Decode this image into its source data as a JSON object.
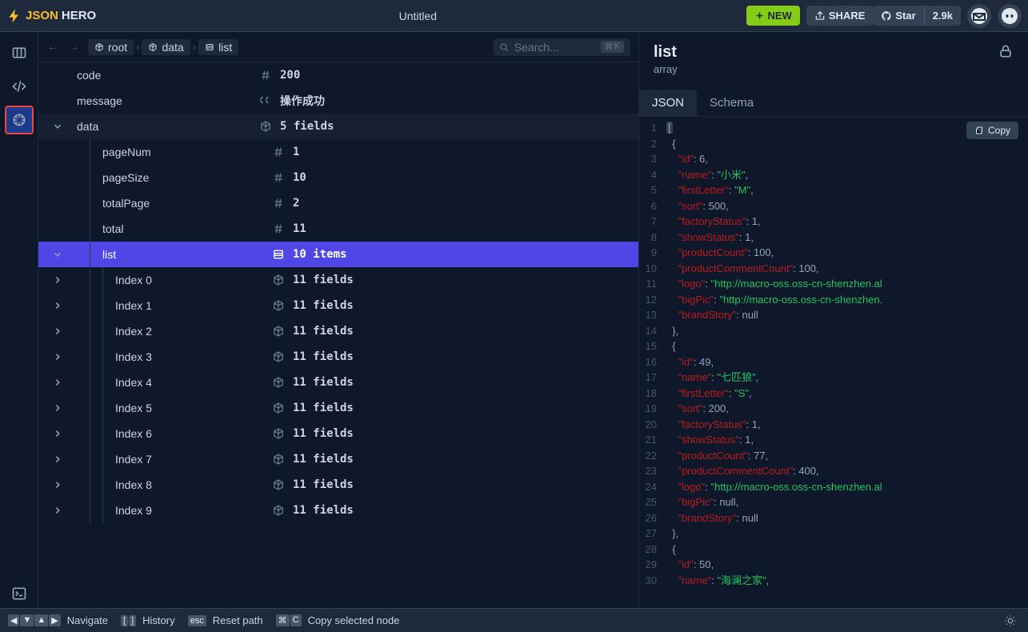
{
  "header": {
    "logo_json": "JSON",
    "logo_hero": "HERO",
    "title": "Untitled",
    "new_label": "NEW",
    "share_label": "SHARE",
    "star_label": "Star",
    "star_count": "2.9k"
  },
  "toolbar": {
    "breadcrumbs": [
      {
        "icon": "cube",
        "label": "root"
      },
      {
        "icon": "cube",
        "label": "data"
      },
      {
        "icon": "list",
        "label": "list"
      }
    ],
    "search_placeholder": "Search...",
    "search_shortcut_mod": "⌘",
    "search_shortcut_key": "K"
  },
  "tree_rows": [
    {
      "depth": 0,
      "chevron": "",
      "label": "code",
      "icon": "hash",
      "value": "200"
    },
    {
      "depth": 0,
      "chevron": "",
      "label": "message",
      "icon": "quote",
      "value": "操作成功"
    },
    {
      "depth": 0,
      "chevron": "down",
      "label": "data",
      "icon": "cube",
      "value": "5 fields",
      "class": "data-row"
    },
    {
      "depth": 1,
      "chevron": "",
      "label": "pageNum",
      "icon": "hash",
      "value": "1"
    },
    {
      "depth": 1,
      "chevron": "",
      "label": "pageSize",
      "icon": "hash",
      "value": "10"
    },
    {
      "depth": 1,
      "chevron": "",
      "label": "totalPage",
      "icon": "hash",
      "value": "2"
    },
    {
      "depth": 1,
      "chevron": "",
      "label": "total",
      "icon": "hash",
      "value": "11"
    },
    {
      "depth": 1,
      "chevron": "down",
      "label": "list",
      "icon": "list",
      "value": "10 items",
      "selected": true
    },
    {
      "depth": 2,
      "chevron": "right",
      "label": "Index 0",
      "icon": "cube",
      "value": "11 fields"
    },
    {
      "depth": 2,
      "chevron": "right",
      "label": "Index 1",
      "icon": "cube",
      "value": "11 fields"
    },
    {
      "depth": 2,
      "chevron": "right",
      "label": "Index 2",
      "icon": "cube",
      "value": "11 fields"
    },
    {
      "depth": 2,
      "chevron": "right",
      "label": "Index 3",
      "icon": "cube",
      "value": "11 fields"
    },
    {
      "depth": 2,
      "chevron": "right",
      "label": "Index 4",
      "icon": "cube",
      "value": "11 fields"
    },
    {
      "depth": 2,
      "chevron": "right",
      "label": "Index 5",
      "icon": "cube",
      "value": "11 fields"
    },
    {
      "depth": 2,
      "chevron": "right",
      "label": "Index 6",
      "icon": "cube",
      "value": "11 fields"
    },
    {
      "depth": 2,
      "chevron": "right",
      "label": "Index 7",
      "icon": "cube",
      "value": "11 fields"
    },
    {
      "depth": 2,
      "chevron": "right",
      "label": "Index 8",
      "icon": "cube",
      "value": "11 fields"
    },
    {
      "depth": 2,
      "chevron": "right",
      "label": "Index 9",
      "icon": "cube",
      "value": "11 fields"
    }
  ],
  "right": {
    "title": "list",
    "type": "array",
    "tab_json": "JSON",
    "tab_schema": "Schema",
    "copy_label": "Copy"
  },
  "code_lines": [
    {
      "n": 1,
      "t": [
        {
          "c": "p",
          "v": "[",
          "hl": true
        }
      ]
    },
    {
      "n": 2,
      "t": [
        {
          "c": "p",
          "v": "  {"
        }
      ]
    },
    {
      "n": 3,
      "t": [
        {
          "c": "p",
          "v": "    "
        },
        {
          "c": "k",
          "v": "\"id\""
        },
        {
          "c": "p",
          "v": ": "
        },
        {
          "c": "n",
          "v": "6"
        },
        {
          "c": "p",
          "v": ","
        }
      ]
    },
    {
      "n": 4,
      "t": [
        {
          "c": "p",
          "v": "    "
        },
        {
          "c": "k",
          "v": "\"name\""
        },
        {
          "c": "p",
          "v": ": "
        },
        {
          "c": "s",
          "v": "\"小米\""
        },
        {
          "c": "p",
          "v": ","
        }
      ]
    },
    {
      "n": 5,
      "t": [
        {
          "c": "p",
          "v": "    "
        },
        {
          "c": "k",
          "v": "\"firstLetter\""
        },
        {
          "c": "p",
          "v": ": "
        },
        {
          "c": "s",
          "v": "\"M\""
        },
        {
          "c": "p",
          "v": ","
        }
      ]
    },
    {
      "n": 6,
      "t": [
        {
          "c": "p",
          "v": "    "
        },
        {
          "c": "k",
          "v": "\"sort\""
        },
        {
          "c": "p",
          "v": ": "
        },
        {
          "c": "n",
          "v": "500"
        },
        {
          "c": "p",
          "v": ","
        }
      ]
    },
    {
      "n": 7,
      "t": [
        {
          "c": "p",
          "v": "    "
        },
        {
          "c": "k",
          "v": "\"factoryStatus\""
        },
        {
          "c": "p",
          "v": ": "
        },
        {
          "c": "n",
          "v": "1"
        },
        {
          "c": "p",
          "v": ","
        }
      ]
    },
    {
      "n": 8,
      "t": [
        {
          "c": "p",
          "v": "    "
        },
        {
          "c": "k",
          "v": "\"showStatus\""
        },
        {
          "c": "p",
          "v": ": "
        },
        {
          "c": "n",
          "v": "1"
        },
        {
          "c": "p",
          "v": ","
        }
      ]
    },
    {
      "n": 9,
      "t": [
        {
          "c": "p",
          "v": "    "
        },
        {
          "c": "k",
          "v": "\"productCount\""
        },
        {
          "c": "p",
          "v": ": "
        },
        {
          "c": "n",
          "v": "100"
        },
        {
          "c": "p",
          "v": ","
        }
      ]
    },
    {
      "n": 10,
      "t": [
        {
          "c": "p",
          "v": "    "
        },
        {
          "c": "k",
          "v": "\"productCommentCount\""
        },
        {
          "c": "p",
          "v": ": "
        },
        {
          "c": "n",
          "v": "100"
        },
        {
          "c": "p",
          "v": ","
        }
      ]
    },
    {
      "n": 11,
      "t": [
        {
          "c": "p",
          "v": "    "
        },
        {
          "c": "k",
          "v": "\"logo\""
        },
        {
          "c": "p",
          "v": ": "
        },
        {
          "c": "s",
          "v": "\"http://macro-oss.oss-cn-shenzhen.al"
        }
      ]
    },
    {
      "n": 12,
      "t": [
        {
          "c": "p",
          "v": "    "
        },
        {
          "c": "k",
          "v": "\"bigPic\""
        },
        {
          "c": "p",
          "v": ": "
        },
        {
          "c": "s",
          "v": "\"http://macro-oss.oss-cn-shenzhen."
        }
      ]
    },
    {
      "n": 13,
      "t": [
        {
          "c": "p",
          "v": "    "
        },
        {
          "c": "k",
          "v": "\"brandStory\""
        },
        {
          "c": "p",
          "v": ": "
        },
        {
          "c": "v",
          "v": "null"
        }
      ]
    },
    {
      "n": 14,
      "t": [
        {
          "c": "p",
          "v": "  },"
        }
      ]
    },
    {
      "n": 15,
      "t": [
        {
          "c": "p",
          "v": "  {"
        }
      ]
    },
    {
      "n": 16,
      "t": [
        {
          "c": "p",
          "v": "    "
        },
        {
          "c": "k",
          "v": "\"id\""
        },
        {
          "c": "p",
          "v": ": "
        },
        {
          "c": "n",
          "v": "49"
        },
        {
          "c": "p",
          "v": ","
        }
      ]
    },
    {
      "n": 17,
      "t": [
        {
          "c": "p",
          "v": "    "
        },
        {
          "c": "k",
          "v": "\"name\""
        },
        {
          "c": "p",
          "v": ": "
        },
        {
          "c": "s",
          "v": "\"七匹狼\""
        },
        {
          "c": "p",
          "v": ","
        }
      ]
    },
    {
      "n": 18,
      "t": [
        {
          "c": "p",
          "v": "    "
        },
        {
          "c": "k",
          "v": "\"firstLetter\""
        },
        {
          "c": "p",
          "v": ": "
        },
        {
          "c": "s",
          "v": "\"S\""
        },
        {
          "c": "p",
          "v": ","
        }
      ]
    },
    {
      "n": 19,
      "t": [
        {
          "c": "p",
          "v": "    "
        },
        {
          "c": "k",
          "v": "\"sort\""
        },
        {
          "c": "p",
          "v": ": "
        },
        {
          "c": "n",
          "v": "200"
        },
        {
          "c": "p",
          "v": ","
        }
      ]
    },
    {
      "n": 20,
      "t": [
        {
          "c": "p",
          "v": "    "
        },
        {
          "c": "k",
          "v": "\"factoryStatus\""
        },
        {
          "c": "p",
          "v": ": "
        },
        {
          "c": "n",
          "v": "1"
        },
        {
          "c": "p",
          "v": ","
        }
      ]
    },
    {
      "n": 21,
      "t": [
        {
          "c": "p",
          "v": "    "
        },
        {
          "c": "k",
          "v": "\"showStatus\""
        },
        {
          "c": "p",
          "v": ": "
        },
        {
          "c": "n",
          "v": "1"
        },
        {
          "c": "p",
          "v": ","
        }
      ]
    },
    {
      "n": 22,
      "t": [
        {
          "c": "p",
          "v": "    "
        },
        {
          "c": "k",
          "v": "\"productCount\""
        },
        {
          "c": "p",
          "v": ": "
        },
        {
          "c": "n",
          "v": "77"
        },
        {
          "c": "p",
          "v": ","
        }
      ]
    },
    {
      "n": 23,
      "t": [
        {
          "c": "p",
          "v": "    "
        },
        {
          "c": "k",
          "v": "\"productCommentCount\""
        },
        {
          "c": "p",
          "v": ": "
        },
        {
          "c": "n",
          "v": "400"
        },
        {
          "c": "p",
          "v": ","
        }
      ]
    },
    {
      "n": 24,
      "t": [
        {
          "c": "p",
          "v": "    "
        },
        {
          "c": "k",
          "v": "\"logo\""
        },
        {
          "c": "p",
          "v": ": "
        },
        {
          "c": "s",
          "v": "\"http://macro-oss.oss-cn-shenzhen.al"
        }
      ]
    },
    {
      "n": 25,
      "t": [
        {
          "c": "p",
          "v": "    "
        },
        {
          "c": "k",
          "v": "\"bigPic\""
        },
        {
          "c": "p",
          "v": ": "
        },
        {
          "c": "v",
          "v": "null"
        },
        {
          "c": "p",
          "v": ","
        }
      ]
    },
    {
      "n": 26,
      "t": [
        {
          "c": "p",
          "v": "    "
        },
        {
          "c": "k",
          "v": "\"brandStory\""
        },
        {
          "c": "p",
          "v": ": "
        },
        {
          "c": "v",
          "v": "null"
        }
      ]
    },
    {
      "n": 27,
      "t": [
        {
          "c": "p",
          "v": "  },"
        }
      ]
    },
    {
      "n": 28,
      "t": [
        {
          "c": "p",
          "v": "  {"
        }
      ]
    },
    {
      "n": 29,
      "t": [
        {
          "c": "p",
          "v": "    "
        },
        {
          "c": "k",
          "v": "\"id\""
        },
        {
          "c": "p",
          "v": ": "
        },
        {
          "c": "n",
          "v": "50"
        },
        {
          "c": "p",
          "v": ","
        }
      ]
    },
    {
      "n": 30,
      "t": [
        {
          "c": "p",
          "v": "    "
        },
        {
          "c": "k",
          "v": "\"name\""
        },
        {
          "c": "p",
          "v": ": "
        },
        {
          "c": "s",
          "v": "\"海澜之家\""
        },
        {
          "c": "p",
          "v": ","
        }
      ]
    }
  ],
  "footer": {
    "navigate": "Navigate",
    "history": "History",
    "reset": "Reset path",
    "copy": "Copy selected node"
  }
}
